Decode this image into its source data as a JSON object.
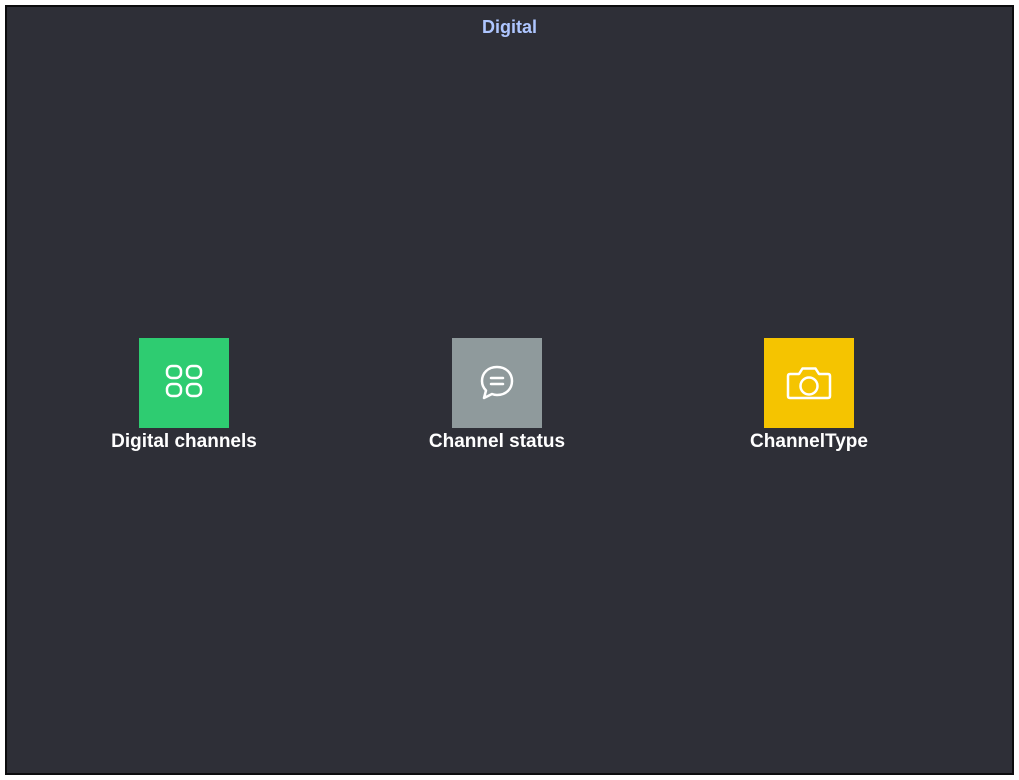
{
  "header": {
    "title": "Digital"
  },
  "tiles": [
    {
      "label": "Digital channels",
      "icon": "grid-icon",
      "color": "#2ecc71"
    },
    {
      "label": "Channel status",
      "icon": "chat-bubble-icon",
      "color": "#8f9a9c"
    },
    {
      "label": "ChannelType",
      "icon": "camera-icon",
      "color": "#f5c400"
    }
  ],
  "theme": {
    "background": "#2e2f37",
    "title_color": "#aec6ff",
    "label_color": "#ffffff"
  }
}
